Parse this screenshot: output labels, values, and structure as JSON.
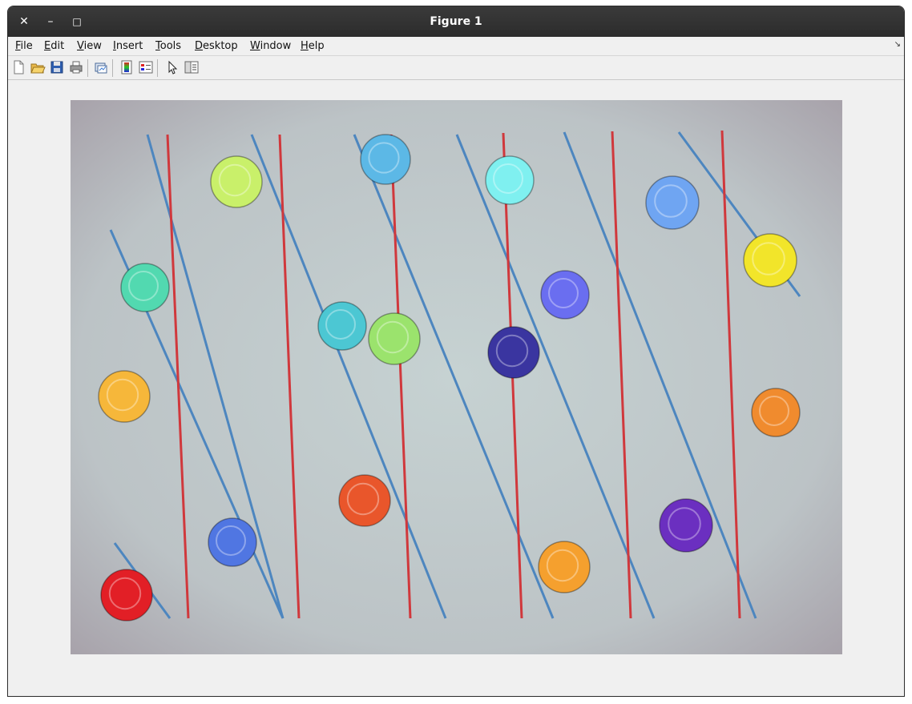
{
  "window": {
    "title": "Figure 1",
    "controls": {
      "close_glyph": "✕",
      "minimize_glyph": "–",
      "maximize_glyph": "□"
    }
  },
  "menubar": {
    "items": [
      {
        "key": "F",
        "rest": "ile"
      },
      {
        "key": "E",
        "rest": "dit"
      },
      {
        "key": "V",
        "rest": "iew"
      },
      {
        "key": "I",
        "rest": "nsert"
      },
      {
        "key": "T",
        "rest": "ools"
      },
      {
        "key": "D",
        "rest": "esktop"
      },
      {
        "key": "W",
        "rest": "indow"
      },
      {
        "key": "H",
        "rest": "elp"
      }
    ],
    "dock_arrow": "↘"
  },
  "toolbar": {
    "icons": [
      "new-figure-icon",
      "open-file-icon",
      "save-icon",
      "print-icon",
      "link-plot-icon",
      "colorbar-icon",
      "legend-icon",
      "edit-plot-arrow-icon",
      "property-inspector-icon"
    ]
  },
  "image": {
    "description_colors": {
      "paper": "#bcc3c6",
      "red_line": "#d0383c",
      "blue_line": "#4d86bf"
    },
    "coins": [
      {
        "color": "#c9f06a"
      },
      {
        "color": "#5cb8e6"
      },
      {
        "color": "#7ff0f0"
      },
      {
        "color": "#6fa5f2"
      },
      {
        "color": "#52d9b0"
      },
      {
        "color": "#f2e52a"
      },
      {
        "color": "#4cc7d3"
      },
      {
        "color": "#9be36d"
      },
      {
        "color": "#6a6ef0"
      },
      {
        "color": "#3a35a0"
      },
      {
        "color": "#f6b73a"
      },
      {
        "color": "#f08b2e"
      },
      {
        "color": "#e9562b"
      },
      {
        "color": "#5076e2"
      },
      {
        "color": "#6b2fc0"
      },
      {
        "color": "#f5a02e"
      },
      {
        "color": "#e21f26"
      }
    ]
  }
}
